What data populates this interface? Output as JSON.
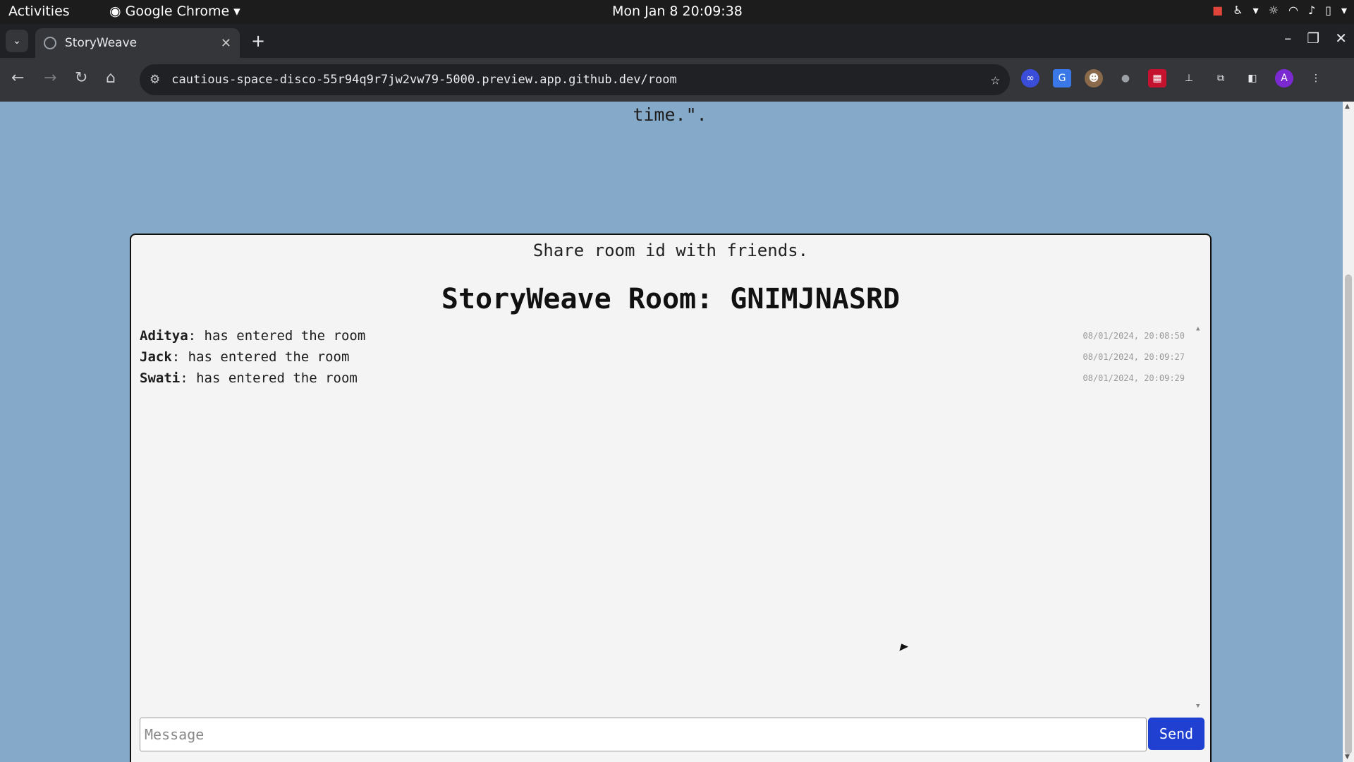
{
  "system_bar": {
    "activities": "Activities",
    "app_name": "Google Chrome",
    "clock": "Mon Jan 8  20:09:38"
  },
  "browser": {
    "tab_title": "StoryWeave",
    "url": "cautious-space-disco-55r94q9r7jw2vw79-5000.preview.app.github.dev/room",
    "profile_initial": "A"
  },
  "page": {
    "story_tail": "time.\".",
    "share_text": "Share room id with friends.",
    "room_title": "StoryWeave Room: GNIMJNASRD",
    "messages": [
      {
        "user": "Aditya",
        "text": ": has entered the room",
        "time": "08/01/2024, 20:08:50"
      },
      {
        "user": "Jack",
        "text": ": has entered the room",
        "time": "08/01/2024, 20:09:27"
      },
      {
        "user": "Swati",
        "text": ": has entered the room",
        "time": "08/01/2024, 20:09:29"
      }
    ],
    "message_placeholder": "Message",
    "send_label": "Send"
  },
  "colors": {
    "page_bg": "#85a9c8",
    "send_button": "#1f40d1"
  }
}
